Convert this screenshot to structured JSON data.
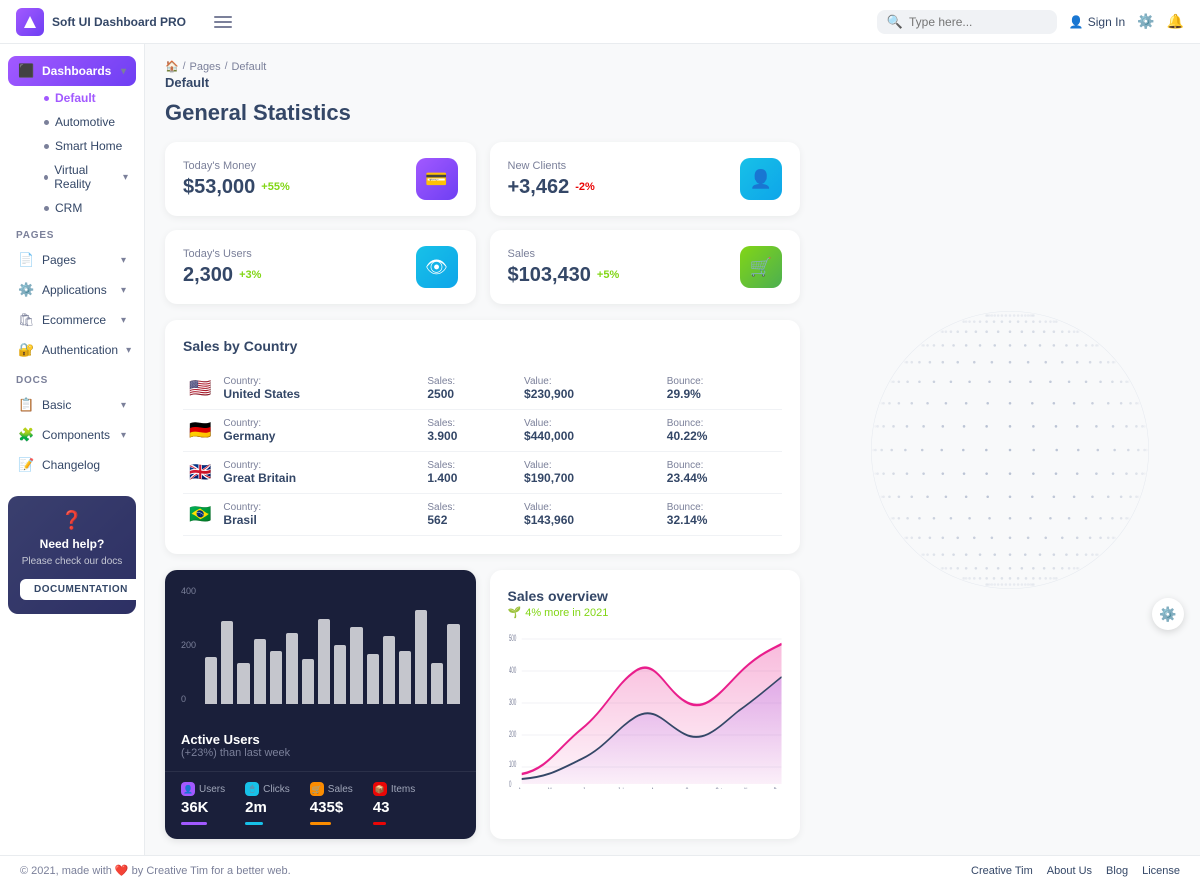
{
  "brand": {
    "name": "Soft UI Dashboard PRO"
  },
  "topnav": {
    "search_placeholder": "Type here...",
    "sign_in": "Sign In"
  },
  "breadcrumb": {
    "home": "Pages",
    "current": "Default",
    "page_title": "Default"
  },
  "page": {
    "title": "General Statistics"
  },
  "stat_cards": [
    {
      "label": "Today's Money",
      "value": "$53,000",
      "badge": "+55%",
      "badge_type": "positive",
      "icon": "💳",
      "icon_class": "purple"
    },
    {
      "label": "New Clients",
      "value": "+3,462",
      "badge": "-2%",
      "badge_type": "negative",
      "icon": "👤",
      "icon_class": "info"
    },
    {
      "label": "Today's Users",
      "value": "2,300",
      "badge": "+3%",
      "badge_type": "positive",
      "icon": "👁",
      "icon_class": "info"
    },
    {
      "label": "Sales",
      "value": "$103,430",
      "badge": "+5%",
      "badge_type": "positive",
      "icon": "🛒",
      "icon_class": "success"
    }
  ],
  "sales_by_country": {
    "title": "Sales by Country",
    "rows": [
      {
        "flag": "🇺🇸",
        "country": "United States",
        "sales_label": "Sales:",
        "sales": "2500",
        "value_label": "Value:",
        "value": "$230,900",
        "bounce_label": "Bounce:",
        "bounce": "29.9%"
      },
      {
        "flag": "🇩🇪",
        "country": "Germany",
        "sales_label": "Sales:",
        "sales": "3.900",
        "value_label": "Value:",
        "value": "$440,000",
        "bounce_label": "Bounce:",
        "bounce": "40.22%"
      },
      {
        "flag": "🇬🇧",
        "country": "Great Britain",
        "sales_label": "Sales:",
        "sales": "1.400",
        "value_label": "Value:",
        "value": "$190,700",
        "bounce_label": "Bounce:",
        "bounce": "23.44%"
      },
      {
        "flag": "🇧🇷",
        "country": "Brasil",
        "sales_label": "Sales:",
        "sales": "562",
        "value_label": "Value:",
        "value": "$143,960",
        "bounce_label": "Bounce:",
        "bounce": "32.14%"
      }
    ]
  },
  "bar_chart": {
    "title": "Active Users",
    "subtitle": "(+23%) than last week",
    "y_labels": [
      "400",
      "200",
      "0"
    ],
    "bars": [
      40,
      70,
      35,
      55,
      45,
      60,
      38,
      72,
      50,
      65,
      42,
      58,
      45,
      80,
      35,
      68
    ],
    "mini_stats": [
      {
        "label": "Users",
        "value": "36K",
        "icon": "👤",
        "icon_class": "purple",
        "bar_width": "60%"
      },
      {
        "label": "Clicks",
        "value": "2m",
        "icon": "🖱",
        "icon_class": "blue",
        "bar_width": "40%"
      },
      {
        "label": "Sales",
        "value": "435$",
        "icon": "🛒",
        "icon_class": "orange",
        "bar_width": "50%"
      },
      {
        "label": "Items",
        "value": "43",
        "icon": "📦",
        "icon_class": "red",
        "bar_width": "30%"
      }
    ]
  },
  "line_chart": {
    "title": "Sales overview",
    "subtitle": "4% more in 2021",
    "x_labels": [
      "Apr",
      "May",
      "Jun",
      "Jul",
      "Aug",
      "Sep",
      "Oct",
      "Nov",
      "Dec"
    ],
    "y_labels": [
      "500",
      "400",
      "300",
      "200",
      "100",
      "0"
    ]
  },
  "sidebar": {
    "dashboards_label": "Dashboards",
    "dashboard_items": [
      {
        "label": "Default",
        "active": true
      },
      {
        "label": "Automotive"
      },
      {
        "label": "Smart Home"
      },
      {
        "label": "Virtual Reality"
      },
      {
        "label": "CRM"
      }
    ],
    "pages_label": "PAGES",
    "nav_items": [
      {
        "label": "Pages",
        "icon": "📄"
      },
      {
        "label": "Applications",
        "icon": "⚙️"
      },
      {
        "label": "Ecommerce",
        "icon": "🛍"
      },
      {
        "label": "Authentication",
        "icon": "🔐"
      }
    ],
    "docs_label": "DOCS",
    "doc_items": [
      {
        "label": "Basic",
        "icon": "📋"
      },
      {
        "label": "Components",
        "icon": "🧩"
      },
      {
        "label": "Changelog",
        "icon": "📝"
      }
    ],
    "help": {
      "title": "Need help?",
      "description": "Please check our docs",
      "button": "DOCUMENTATION"
    }
  },
  "footer": {
    "copy": "© 2021, made with ❤️ by Creative Tim for a better web.",
    "links": [
      "Creative Tim",
      "About Us",
      "Blog",
      "License"
    ]
  }
}
